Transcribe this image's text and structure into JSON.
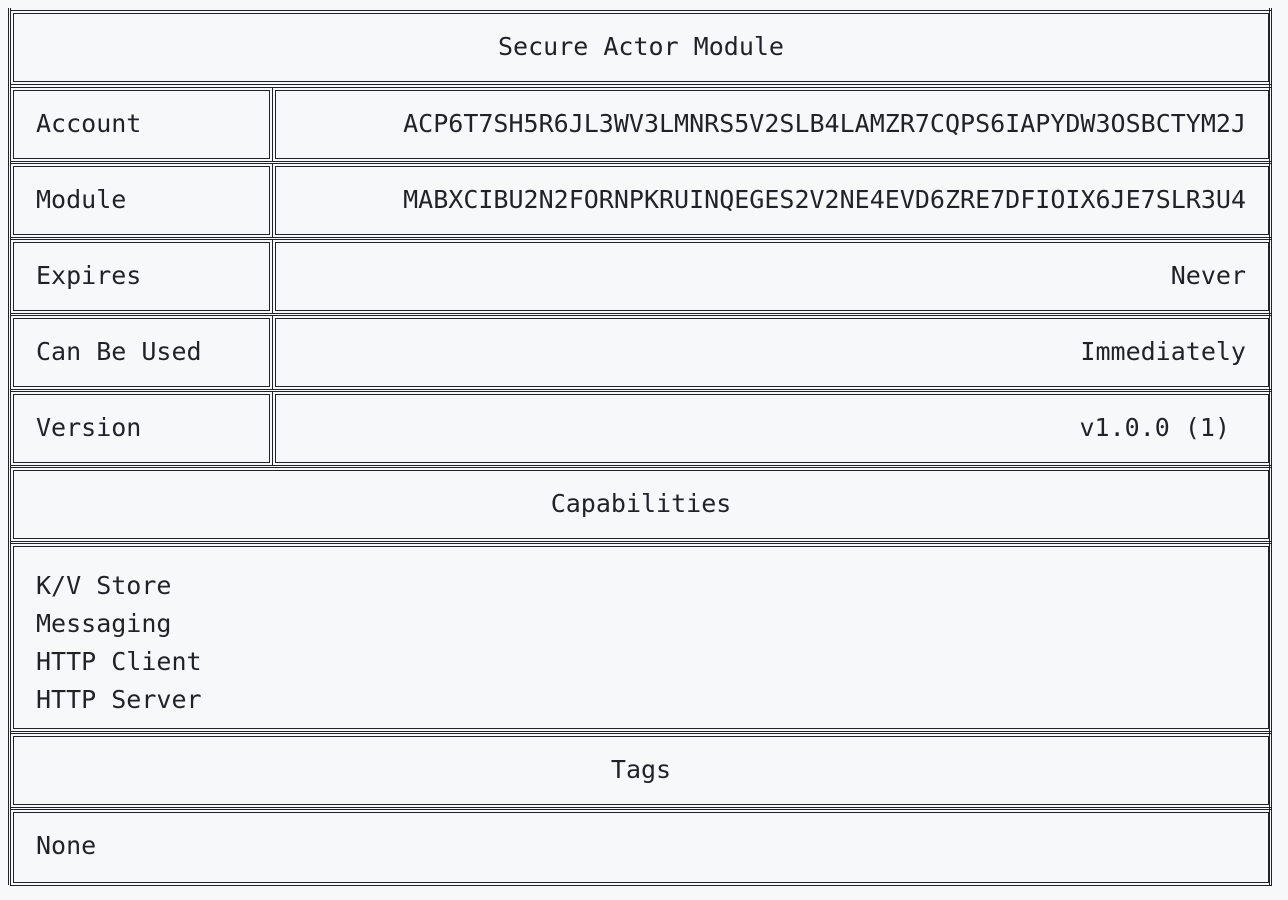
{
  "title": "Secure Actor Module",
  "rows": [
    {
      "label": "Account",
      "value": "ACP6T7SH5R6JL3WV3LMNRS5V2SLB4LAMZR7CQPS6IAPYDW3OSBCTYM2J"
    },
    {
      "label": "Module",
      "value": "MABXCIBU2N2FORNPKRUINQEGES2V2NE4EVD6ZRE7DFIOIX6JE7SLR3U4"
    },
    {
      "label": "Expires",
      "value": "Never"
    },
    {
      "label": "Can Be Used",
      "value": "Immediately"
    },
    {
      "label": "Version",
      "value": "v1.0.0 (1)"
    }
  ],
  "capabilities": {
    "heading": "Capabilities",
    "items": [
      "K/V Store",
      "Messaging",
      "HTTP Client",
      "HTTP Server"
    ]
  },
  "tags": {
    "heading": "Tags",
    "value": "None"
  }
}
